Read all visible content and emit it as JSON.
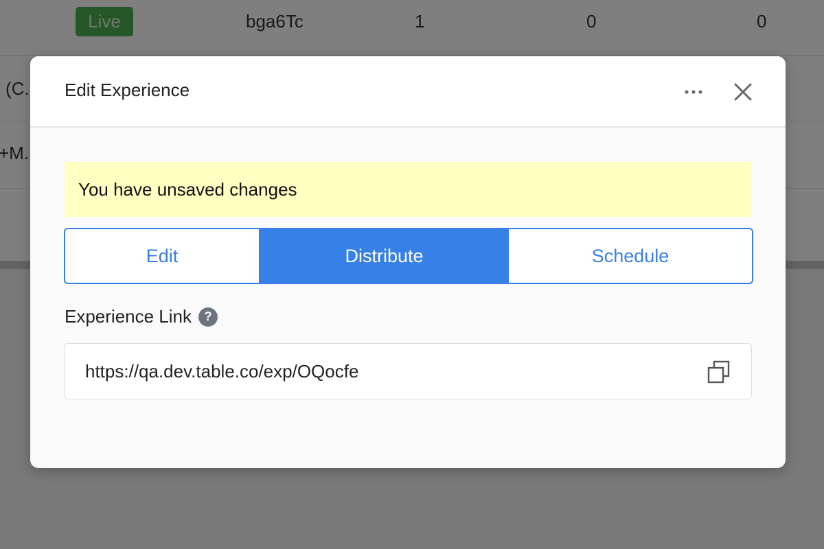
{
  "background": {
    "row1": {
      "status": "Live",
      "code": "bga6Tc",
      "col3": "1",
      "col4": "0",
      "col5": "0"
    },
    "row2": {
      "name_fragment": "(C."
    },
    "row3": {
      "name_fragment": "+M."
    }
  },
  "modal": {
    "title": "Edit Experience",
    "more_icon": "more-horizontal-icon",
    "close_icon": "close-icon",
    "banner": "You have unsaved changes",
    "tabs": [
      {
        "label": "Edit",
        "active": false
      },
      {
        "label": "Distribute",
        "active": true
      },
      {
        "label": "Schedule",
        "active": false
      }
    ],
    "link_label": "Experience Link",
    "help_icon": "?",
    "link_value": "https://qa.dev.table.co/exp/OQocfe",
    "copy_icon": "copy-icon"
  },
  "colors": {
    "accent": "#3a7ee3",
    "active_tab": "#3680e6",
    "banner_bg": "#ffffc2",
    "live_badge": "#4caf50"
  }
}
